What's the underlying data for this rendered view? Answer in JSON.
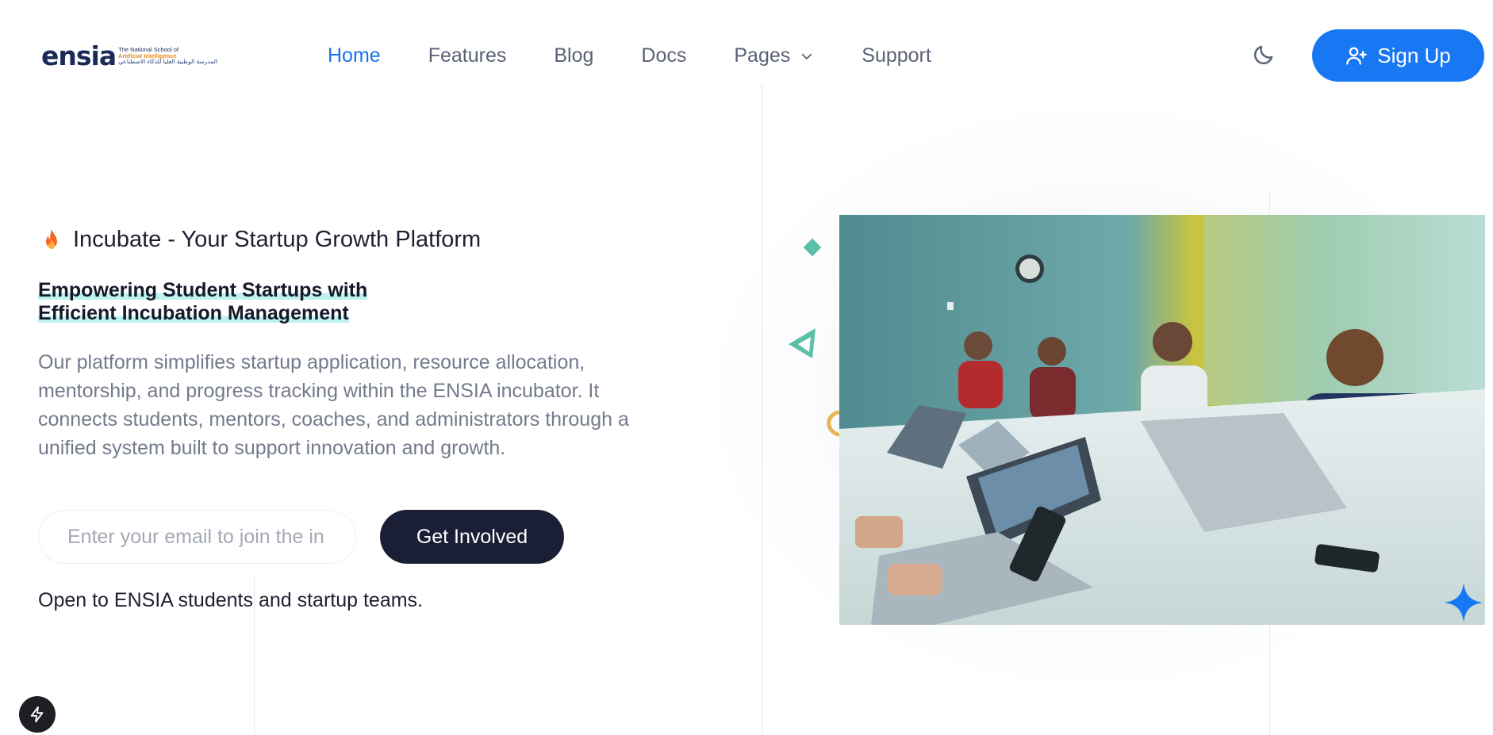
{
  "brand": {
    "word": "ensia",
    "line1": "The National School of",
    "line2": "Artificial Intelligence",
    "line3": "المدرسة الوطنية العليا للذكاء الاصطناعي"
  },
  "nav": {
    "items": [
      {
        "label": "Home",
        "active": true
      },
      {
        "label": "Features"
      },
      {
        "label": "Blog"
      },
      {
        "label": "Docs"
      },
      {
        "label": "Pages",
        "has_dropdown": true
      },
      {
        "label": "Support"
      }
    ]
  },
  "header": {
    "theme_toggle_icon": "moon-icon",
    "signup_label": "Sign Up",
    "signup_icon": "user-plus-icon"
  },
  "hero": {
    "eyebrow_icon": "fire-icon",
    "eyebrow": "Incubate - Your Startup Growth Platform",
    "headline_line1": "Empowering Student Startups with",
    "headline_line2": "Efficient Incubation Management",
    "description": "Our platform simplifies startup application, resource allocation, mentorship, and progress tracking within the ENSIA incubator. It connects students, mentors, coaches, and administrators through a unified system built to support innovation and growth.",
    "email_placeholder": "Enter your email to join the in",
    "cta_label": "Get Involved",
    "note": "Open to ENSIA students and startup teams."
  },
  "colors": {
    "accent": "#1877f2",
    "dark": "#1b1f36",
    "highlight": "#bdf2ee",
    "teal_shape": "#5bc0a8"
  },
  "widgets": {
    "dev_tools_icon": "lightning-icon"
  }
}
